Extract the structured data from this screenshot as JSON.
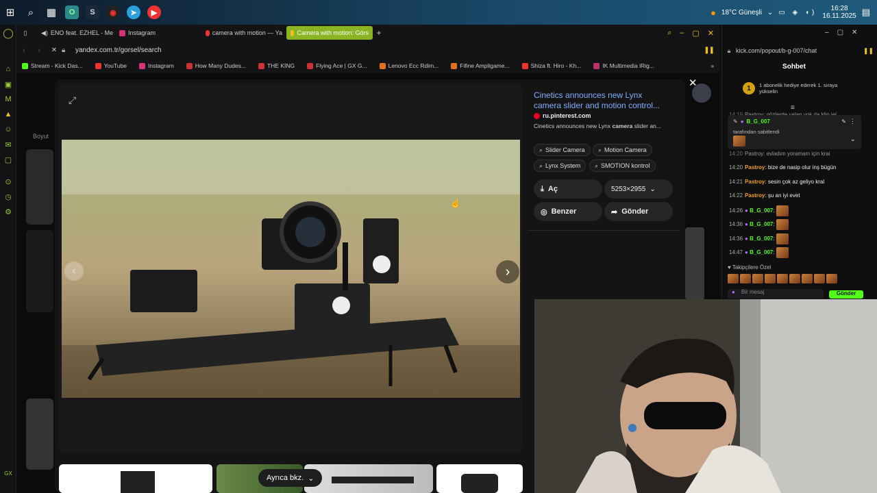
{
  "taskbar": {
    "weather": "18°C  Güneşli",
    "time": "16:28",
    "date": "16.11.2025"
  },
  "browser": {
    "tabs": [
      {
        "label": "ENO feat. EZHEL - Me",
        "color": "#e33"
      },
      {
        "label": "Instagram",
        "color": "#d6337a"
      },
      {
        "label": "camera with motion — Ya",
        "color": "#e33"
      },
      {
        "label": "Camera with motion: Görs",
        "color": "#f0c020"
      }
    ],
    "url": "yandex.com.tr/gorsel/search",
    "bookmarks": [
      {
        "label": "Stream - Kick Das...",
        "color": "#53fc18"
      },
      {
        "label": "YouTube",
        "color": "#e33"
      },
      {
        "label": "Instagram",
        "color": "#d6337a"
      },
      {
        "label": "How Many Dudes...",
        "color": "#c33"
      },
      {
        "label": "THE KİNG",
        "color": "#c33"
      },
      {
        "label": "Flying Ace | GX G...",
        "color": "#c33"
      },
      {
        "label": "Lenovo Ecc Rdim...",
        "color": "#e07020"
      },
      {
        "label": "Fifine Ampligame...",
        "color": "#e07020"
      },
      {
        "label": "Shiza ft. Hiro - Kh...",
        "color": "#e33"
      },
      {
        "label": "IK Multimedia iRig...",
        "color": "#b36"
      }
    ]
  },
  "result": {
    "title": "Cinetics announces new Lynx camera slider and motion control...",
    "source": "ru.pinterest.com",
    "description_pre": "Cinetics announces new Lynx ",
    "description_bold": "camera",
    "description_post": " slider an...",
    "chips": [
      "Slider Camera",
      "Motion Camera",
      "Lynx System",
      "SMOTION kontrol"
    ],
    "open_label": "Aç",
    "size_label": "5253×2955",
    "similar_label": "Benzer",
    "send_label": "Gönder"
  },
  "left_label": "Boyut",
  "see_also_label": "Ayrıca bkz.",
  "chat": {
    "url": "kick.com/popout/b-g-007/chat",
    "title": "Sohbet",
    "promo": "1 abonelik hediye ederek 1. sıraya yükselin",
    "promo_num": "1",
    "pinned_user": "B_G_007",
    "pinned_by": "tarafından sabitlendi",
    "partial_top": "Pastroy: gözlerde yalan yok da klip iel",
    "partial_2": "Pastroy: evladım yoramam için krai",
    "messages": [
      {
        "time": "14:20",
        "user": "Pastroy",
        "text": "bize de nasip olur inş bügün"
      },
      {
        "time": "14:21",
        "user": "Pastroy",
        "text": "sesin çok az geliyo kral"
      },
      {
        "time": "14:22",
        "user": "Pastroy",
        "text": "şu an iyi evet"
      },
      {
        "time": "14:26",
        "user": "B_G_007",
        "text": ""
      },
      {
        "time": "14:36",
        "user": "B_G_007",
        "text": ""
      },
      {
        "time": "14:36",
        "user": "B_G_007",
        "text": ""
      },
      {
        "time": "14:47",
        "user": "B_G_007",
        "text": ""
      }
    ],
    "followers_label": "Takipçilere Özel",
    "input_placeholder": "Bir mesaj",
    "send_label": "Gönder"
  }
}
